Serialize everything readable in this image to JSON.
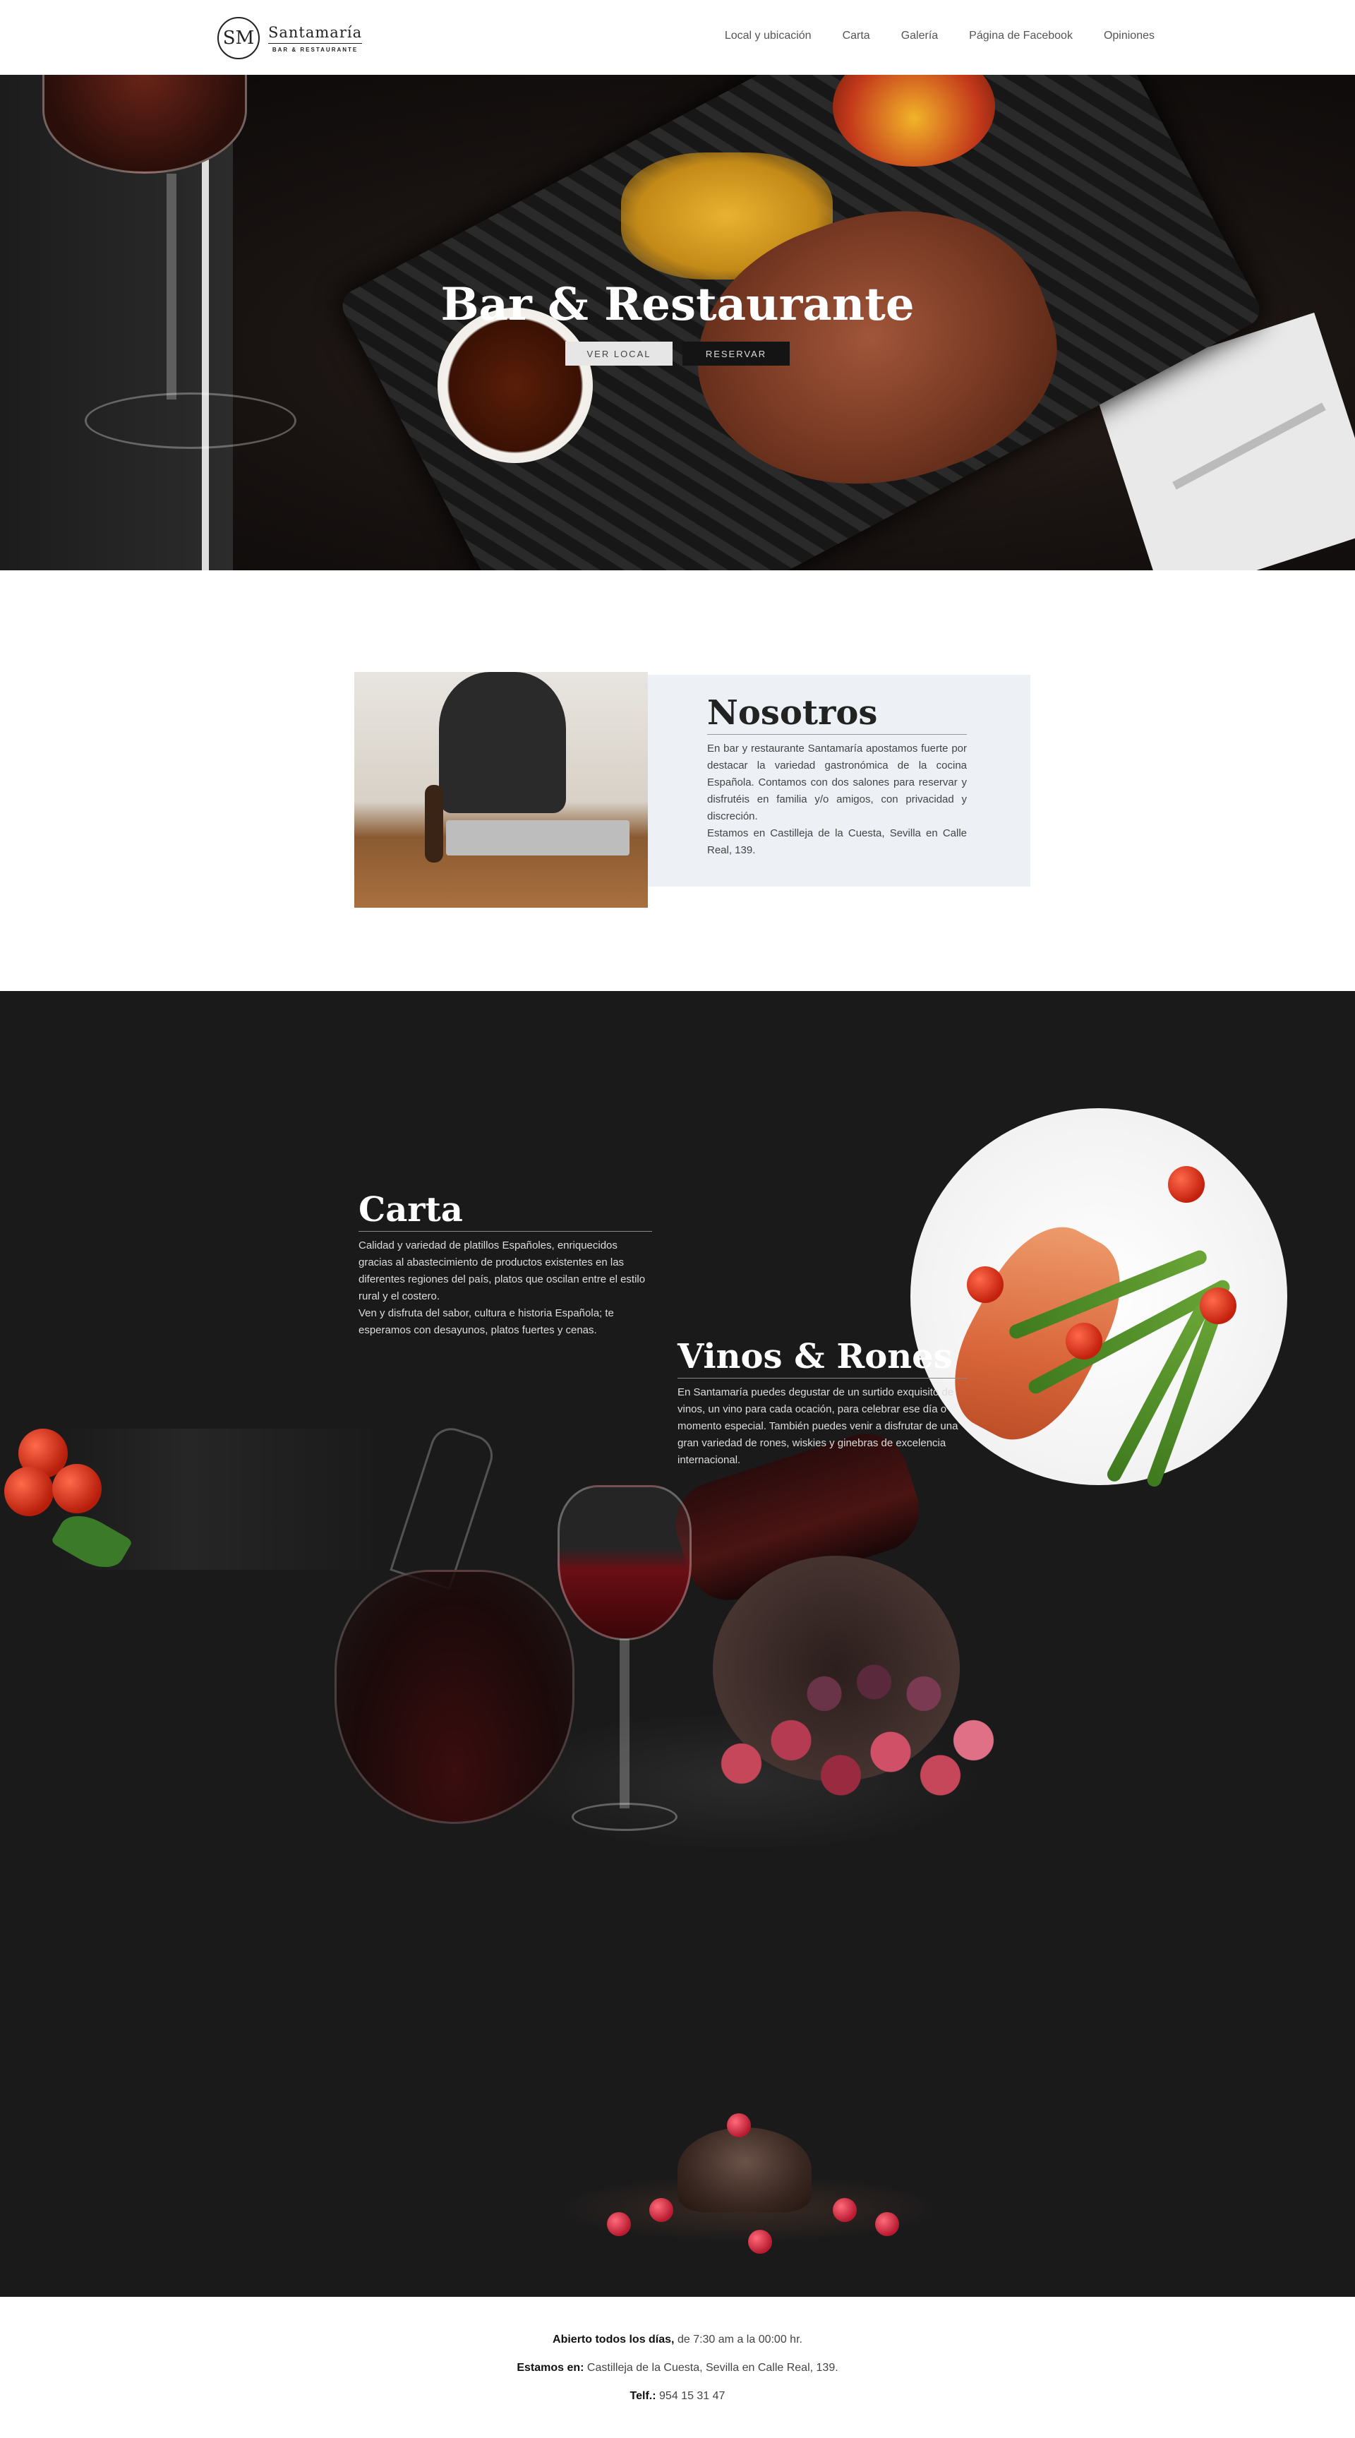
{
  "header": {
    "logo_mark": "SM",
    "logo_name": "Santamaría",
    "logo_sub": "BAR & RESTAURANTE",
    "nav": [
      {
        "label": "Local y ubicación"
      },
      {
        "label": "Carta"
      },
      {
        "label": "Galería"
      },
      {
        "label": "Página de Facebook"
      },
      {
        "label": "Opiniones"
      }
    ]
  },
  "hero": {
    "title": "Bar & Restaurante",
    "btn_primary": "VER LOCAL",
    "btn_secondary": "RESERVAR"
  },
  "about": {
    "title": "Nosotros",
    "p1": "En bar y restaurante Santamaría apostamos fuerte por destacar la variedad gastronómica de la cocina Española. Contamos con dos salones para reservar y disfrutéis en familia y/o amigos, con privacidad y discreción.",
    "p2": "Estamos en Castilleja de la Cuesta, Sevilla en Calle Real, 139."
  },
  "carta": {
    "title": "Carta",
    "p1": "Calidad y variedad de platillos Españoles, enriquecidos gracias al abastecimiento de productos existentes en las diferentes regiones del país, platos que oscilan entre el estilo rural y el costero.",
    "p2": "Ven y disfruta del sabor, cultura e historia Española; te esperamos con desayunos, platos fuertes y cenas."
  },
  "vinos": {
    "title": "Vinos & Rones",
    "p1": "En Santamaría puedes degustar de un surtido exquisito de vinos, un vino para cada ocación, para celebrar ese día o momento especial. También puedes venir a disfrutar de una gran variedad de rones, wiskies y ginebras de excelencia internacional."
  },
  "footer": {
    "hours_label": "Abierto todos los días,",
    "hours_value": " de 7:30 am a la 00:00 hr.",
    "address_label": "Estamos en:",
    "address_value": " Castilleja de la Cuesta, Sevilla en Calle Real, 139.",
    "phone_label": "Telf.:",
    "phone_value": " 954 15 31 47"
  }
}
